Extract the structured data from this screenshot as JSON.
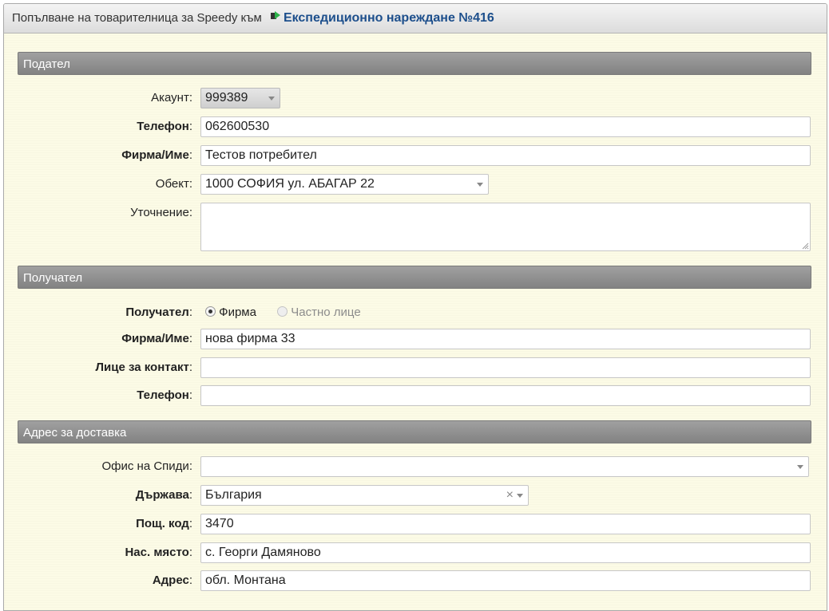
{
  "title": {
    "prefix": "Попълване на товарителница за Speedy към",
    "link": "Експедиционно нареждане №416"
  },
  "sender": {
    "header": "Подател",
    "account_label": "Акаунт",
    "account_value": "999389",
    "phone_label": "Телефон",
    "phone_value": "062600530",
    "name_label": "Фирма/Име",
    "name_value": "Тестов потребител",
    "object_label": "Обект",
    "object_value": "1000 СОФИЯ ул. АБАГАР 22",
    "note_label": "Уточнение",
    "note_value": ""
  },
  "recipient": {
    "header": "Получател",
    "type_label": "Получател",
    "type_options": [
      "Фирма",
      "Частно лице"
    ],
    "type_selected": "Фирма",
    "name_label": "Фирма/Име",
    "name_value": "нова фирма 33",
    "contact_label": "Лице за контакт",
    "contact_value": "",
    "phone_label": "Телефон",
    "phone_value": ""
  },
  "address": {
    "header": "Адрес за доставка",
    "office_label": "Офис на Спиди",
    "office_value": "",
    "country_label": "Държава",
    "country_value": "България",
    "zip_label": "Пощ. код",
    "zip_value": "3470",
    "place_label": "Нас. място",
    "place_value": "с. Георги Дамяново",
    "addr_label": "Адрес",
    "addr_value": "обл. Монтана"
  },
  "colors": {
    "background": "#fcfbe6",
    "section_header": "#8c8c8c",
    "link": "#1d4f8c"
  },
  "icons": {
    "title_icon": "document-arrow-icon",
    "select_arrow": "chevron-down-icon",
    "clear": "clear-x-icon"
  },
  "separator": ":"
}
